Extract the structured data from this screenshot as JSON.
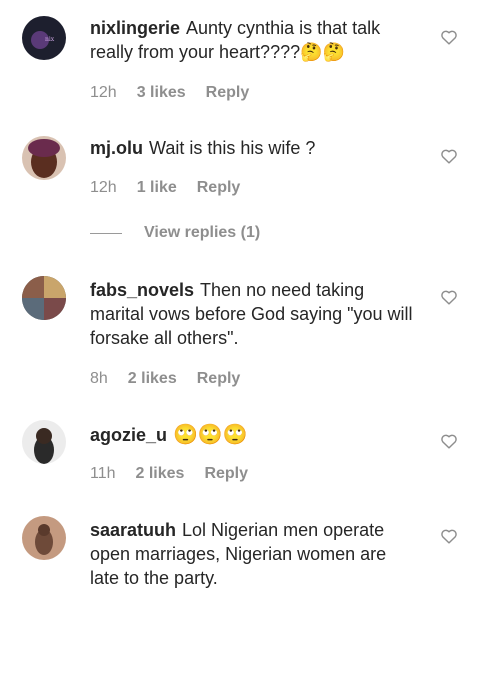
{
  "comments": [
    {
      "username": "nixlingerie",
      "text": "Aunty cynthia is that talk really from your heart????🤔🤔",
      "time": "12h",
      "likes": "3 likes",
      "reply": "Reply",
      "avatar_colors": [
        "#1d1f2e",
        "#5a3a78"
      ]
    },
    {
      "username": "mj.olu",
      "text": "Wait is this his wife ?",
      "time": "12h",
      "likes": "1 like",
      "reply": "Reply",
      "avatar_colors": [
        "#6b3a2a",
        "#e4c9b3"
      ]
    },
    {
      "username": "fabs_novels",
      "text": "Then no need taking marital vows before God saying \"you will forsake all others\".",
      "time": "8h",
      "likes": "2 likes",
      "reply": "Reply",
      "avatar_colors": [
        "#7a6a4a",
        "#c9a56b"
      ]
    },
    {
      "username": "agozie_u",
      "text": "🙄🙄🙄",
      "time": "11h",
      "likes": "2 likes",
      "reply": "Reply",
      "avatar_colors": [
        "#e7e7e7",
        "#222222"
      ]
    },
    {
      "username": "saaratuuh",
      "text": "Lol Nigerian men operate open marriages, Nigerian women are late to the party.",
      "time": "",
      "likes": "",
      "reply": "",
      "avatar_colors": [
        "#b8856b",
        "#6e4a39"
      ]
    }
  ],
  "view_replies": "View replies (1)",
  "icons": {
    "like": "heart-outline-icon"
  },
  "colors": {
    "text": "#262626",
    "muted": "#8e8e8e",
    "icon": "#8e8e8e"
  }
}
